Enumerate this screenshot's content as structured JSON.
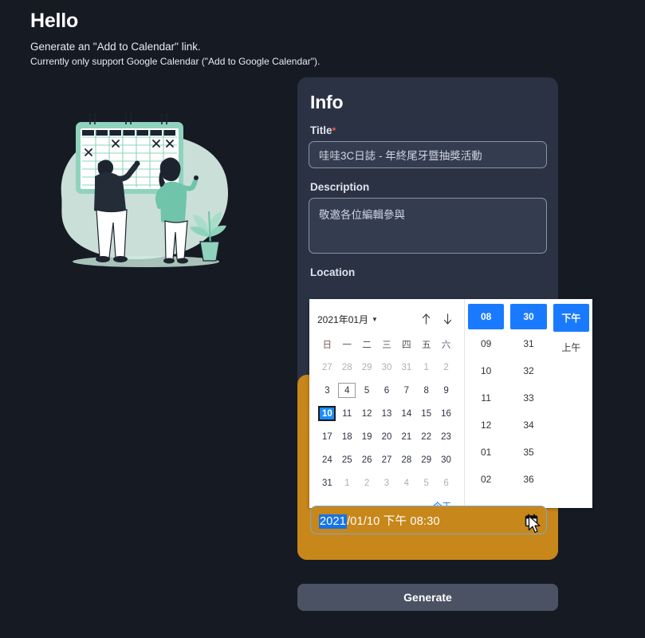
{
  "header": {
    "title": "Hello",
    "line1": "Generate an \"Add to Calendar\" link.",
    "line2": "Currently only support Google Calendar (\"Add to Google Calendar\")."
  },
  "illustration": {
    "name": "calendar-illustration",
    "alt": "Two people marking dates on a large wall calendar with a potted plant"
  },
  "info": {
    "heading": "Info",
    "title_label": "Title",
    "title_required_mark": "*",
    "title_value": "哇哇3C日誌 - 年終尾牙暨抽獎活動",
    "description_label": "Description",
    "description_value": "敬邀各位編輯參與",
    "location_label": "Location"
  },
  "datetime": {
    "value_year": "2021",
    "value_rest": "/01/10 下午 08:30",
    "full_value": "2021/01/10 下午 08:30",
    "calendar_icon": "calendar-icon"
  },
  "actions": {
    "generate_label": "Generate"
  },
  "picker": {
    "month_label": "2021年01月",
    "caret_icon": "chevron-down-icon",
    "prev_icon": "arrow-up-icon",
    "next_icon": "arrow-down-icon",
    "weekdays": [
      "日",
      "一",
      "二",
      "三",
      "四",
      "五",
      "六"
    ],
    "weeks": [
      [
        {
          "d": "27",
          "muted": true
        },
        {
          "d": "28",
          "muted": true
        },
        {
          "d": "29",
          "muted": true
        },
        {
          "d": "30",
          "muted": true
        },
        {
          "d": "31",
          "muted": true
        },
        {
          "d": "1",
          "muted": true
        },
        {
          "d": "2",
          "muted": true
        }
      ],
      [
        {
          "d": "3"
        },
        {
          "d": "4",
          "today": true
        },
        {
          "d": "5"
        },
        {
          "d": "6"
        },
        {
          "d": "7"
        },
        {
          "d": "8"
        },
        {
          "d": "9"
        }
      ],
      [
        {
          "d": "10",
          "selected": true
        },
        {
          "d": "11"
        },
        {
          "d": "12"
        },
        {
          "d": "13"
        },
        {
          "d": "14"
        },
        {
          "d": "15"
        },
        {
          "d": "16"
        }
      ],
      [
        {
          "d": "17"
        },
        {
          "d": "18"
        },
        {
          "d": "19"
        },
        {
          "d": "20"
        },
        {
          "d": "21"
        },
        {
          "d": "22"
        },
        {
          "d": "23"
        }
      ],
      [
        {
          "d": "24"
        },
        {
          "d": "25"
        },
        {
          "d": "26"
        },
        {
          "d": "27"
        },
        {
          "d": "28"
        },
        {
          "d": "29"
        },
        {
          "d": "30"
        }
      ],
      [
        {
          "d": "31"
        },
        {
          "d": "1",
          "muted": true
        },
        {
          "d": "2",
          "muted": true
        },
        {
          "d": "3",
          "muted": true
        },
        {
          "d": "4",
          "muted": true
        },
        {
          "d": "5",
          "muted": true
        },
        {
          "d": "6",
          "muted": true
        }
      ]
    ],
    "today_label": "今天",
    "hours": [
      {
        "v": "08",
        "on": true
      },
      {
        "v": "09"
      },
      {
        "v": "10"
      },
      {
        "v": "11"
      },
      {
        "v": "12"
      },
      {
        "v": "01"
      },
      {
        "v": "02"
      }
    ],
    "minutes": [
      {
        "v": "30",
        "on": true
      },
      {
        "v": "31"
      },
      {
        "v": "32"
      },
      {
        "v": "33"
      },
      {
        "v": "34"
      },
      {
        "v": "35"
      },
      {
        "v": "36"
      }
    ],
    "meridiems": [
      {
        "v": "下午",
        "on": true
      },
      {
        "v": "上午"
      }
    ]
  },
  "colors": {
    "page_bg": "#161a23",
    "card_bg": "#2b3244",
    "highlight_orange": "#c8871a",
    "accent_blue": "#1a7aff",
    "selected_blue": "#1573e6",
    "button_gray": "#4b5264",
    "required_red": "#e8603c",
    "illustration_green": "#76c5ad"
  }
}
